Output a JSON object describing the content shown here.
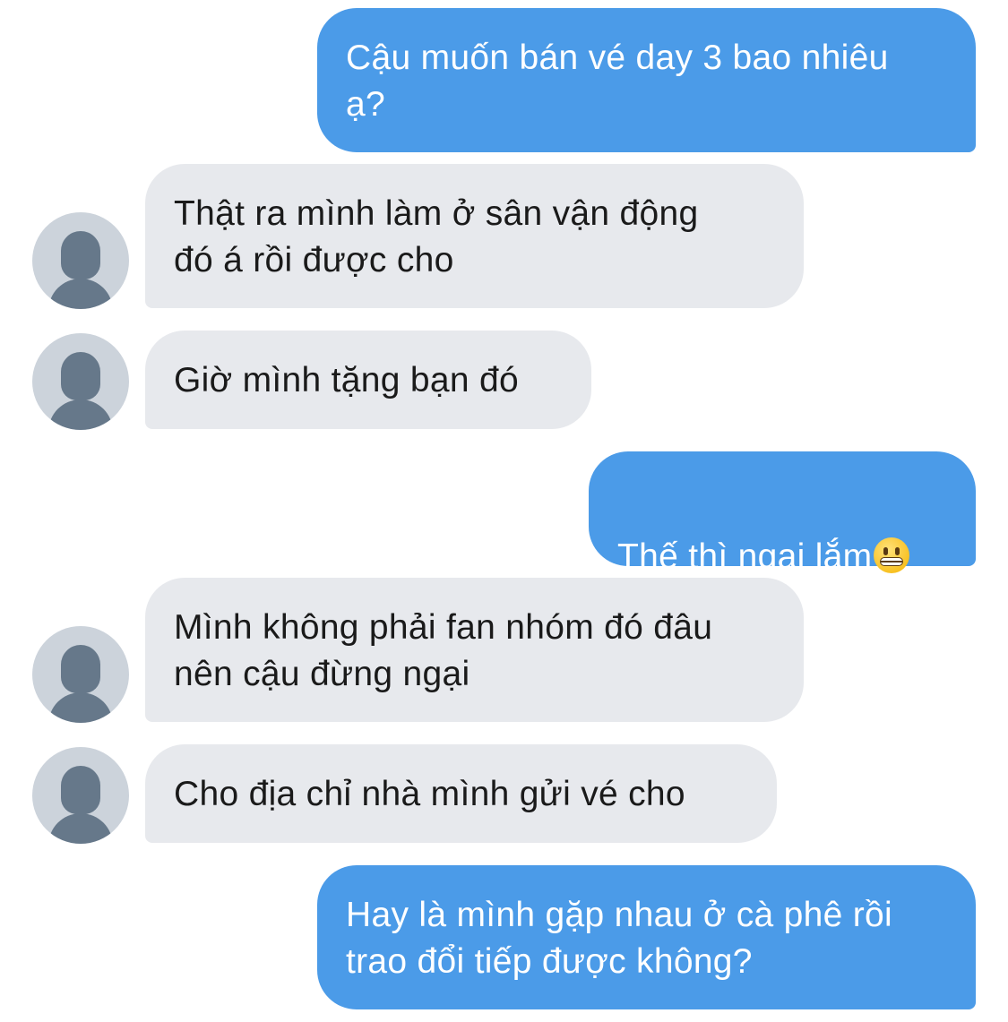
{
  "conversation": {
    "messages": [
      {
        "sender": "me",
        "text": "Cậu muốn bán vé day 3 bao nhiêu\nạ?"
      },
      {
        "sender": "other",
        "text": "Thật ra mình làm ở sân vận động\nđó á rồi được cho"
      },
      {
        "sender": "other",
        "text": "Giờ mình tặng bạn đó"
      },
      {
        "sender": "me",
        "text": "Thế thì ngại lắm",
        "emoji": "grimacing-face-emoji"
      },
      {
        "sender": "other",
        "text": "Mình không phải fan nhóm đó đâu\nnên cậu đừng ngại"
      },
      {
        "sender": "other",
        "text": "Cho địa chỉ nhà mình gửi vé cho"
      },
      {
        "sender": "me",
        "text": "Hay là mình gặp nhau ở cà phê rồi\ntrao đổi tiếp được không?"
      }
    ]
  },
  "colors": {
    "sent_bubble": "#4b9be8",
    "received_bubble": "#e7e9ed",
    "avatar_bg": "#ccd3db",
    "avatar_fg": "#66788a"
  }
}
